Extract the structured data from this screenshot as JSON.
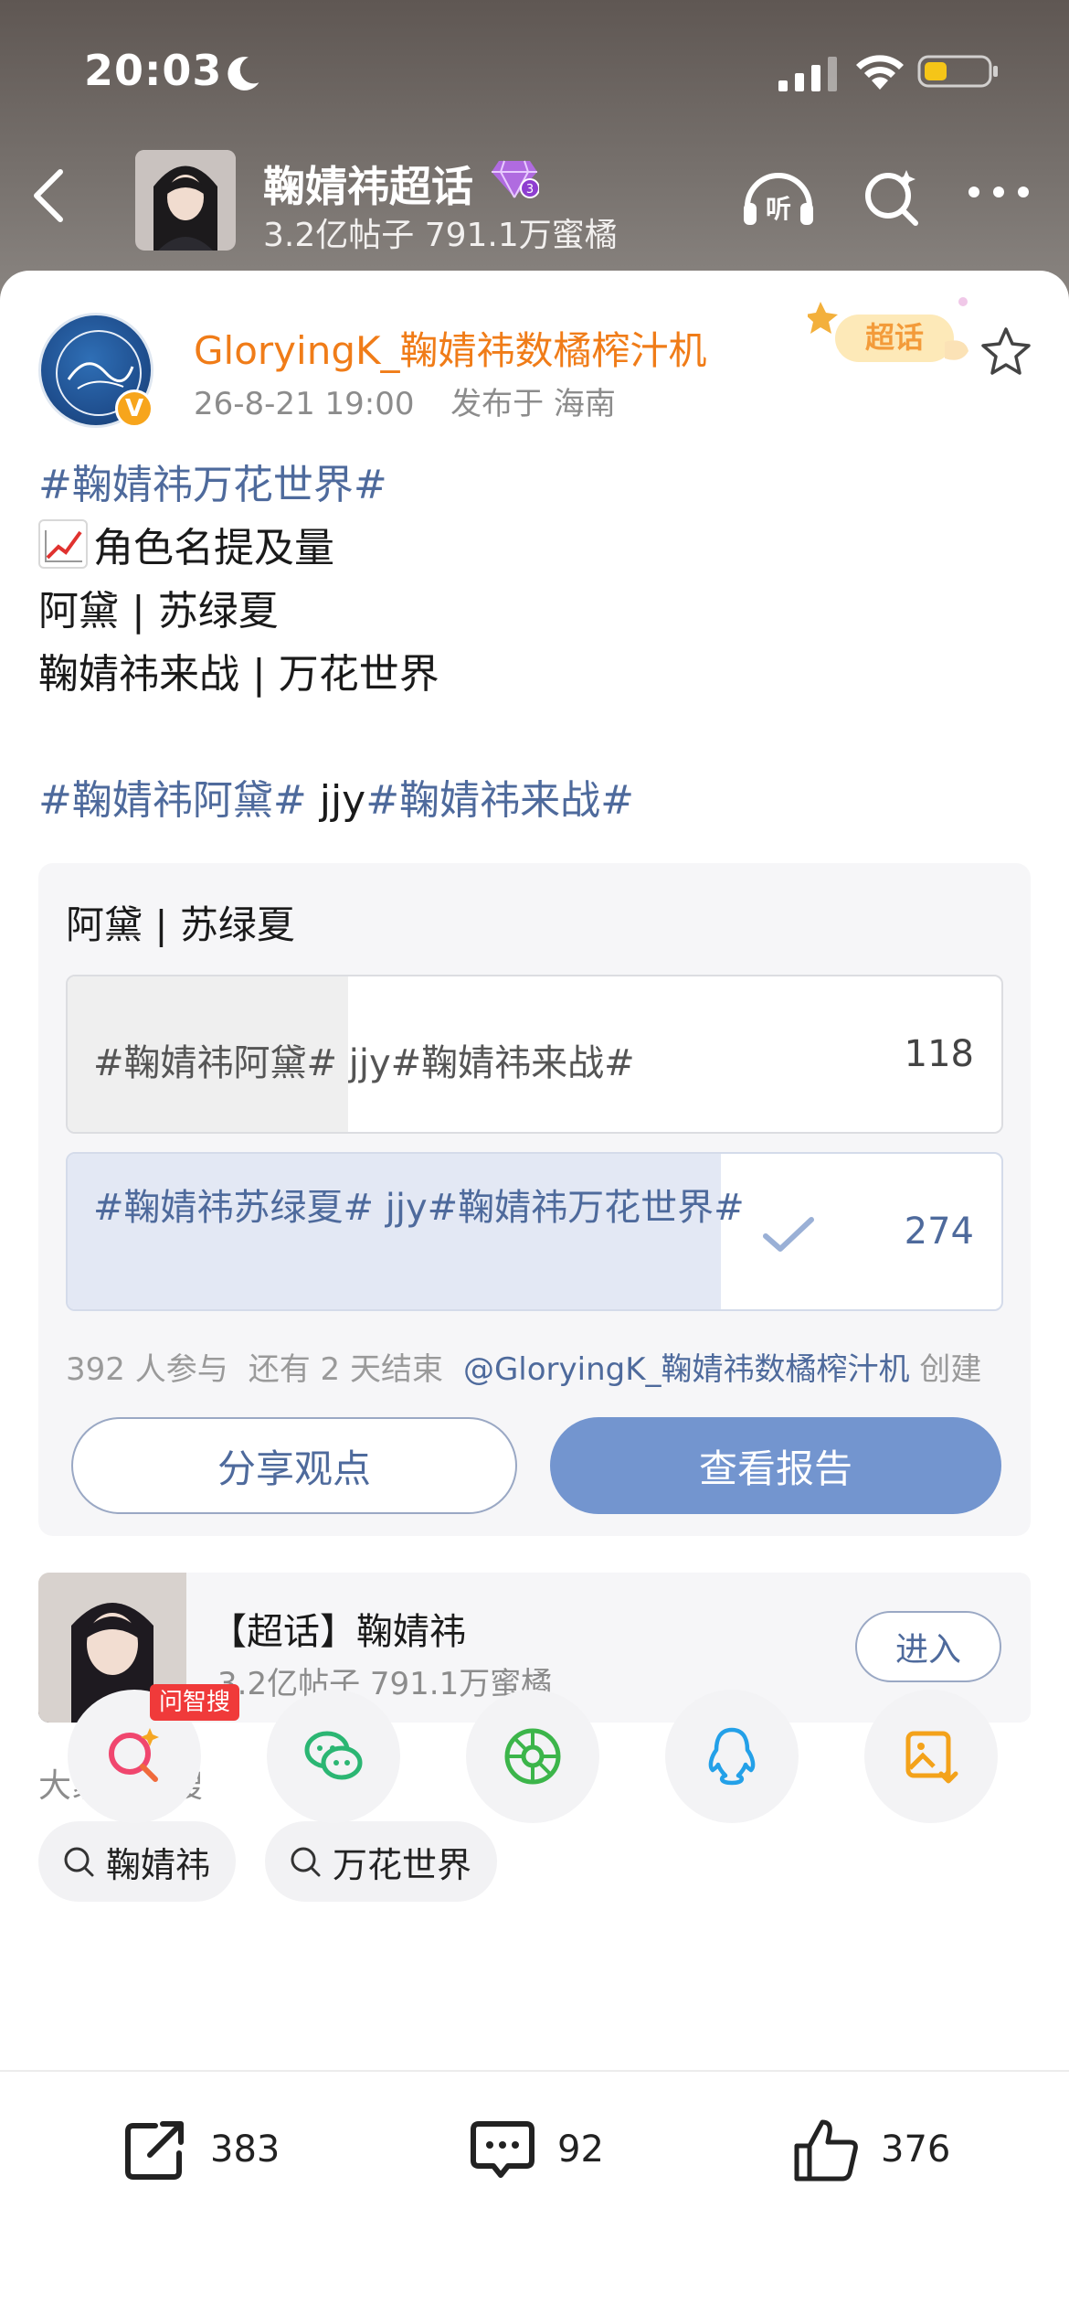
{
  "status_bar": {
    "time": "20:03"
  },
  "nav": {
    "title": "鞠婧祎超话",
    "subtitle": "3.2亿帖子 791.1万蜜橘"
  },
  "post": {
    "author": "GloryingK_鞠婧祎数橘榨汁机",
    "date": "26-8-21 19:00",
    "location": "发布于 海南",
    "supertopic_badge": "超话",
    "lines": {
      "l1": "#鞠婧祎万花世界#",
      "l2": "角色名提及量",
      "l3": "阿黛 | 苏绿夏",
      "l4": "鞠婧祎来战 | 万花世界",
      "l6_tag1": "#鞠婧祎阿黛#",
      "l6_mid": " jjy",
      "l6_tag2": "#鞠婧祎来战#"
    }
  },
  "poll": {
    "title": "阿黛 | 苏绿夏",
    "options": [
      {
        "text": "#鞠婧祎阿黛# jjy#鞠婧祎来战#",
        "count": "118",
        "share": 0.3
      },
      {
        "text": "#鞠婧祎苏绿夏# jjy#鞠婧祎万花世界#",
        "count": "274",
        "share": 0.7,
        "selected": true
      }
    ],
    "participants": "392 人参与",
    "remaining": "还有 2 天结束",
    "creator": "@GloryingK_鞠婧祎数橘榨汁机",
    "created_label": "创建",
    "share_btn": "分享观点",
    "report_btn": "查看报告"
  },
  "topic_card": {
    "name": "【超话】鞠婧祎",
    "sub": "3.2亿帖子 791.1万蜜橘",
    "enter": "进入"
  },
  "search": {
    "heading": "大家都在搜",
    "chips": [
      "鞠婧祎",
      "万花世界"
    ]
  },
  "share_targets": {
    "ai_tag": "问智搜",
    "items": [
      "ai-search-icon",
      "wechat-icon",
      "moments-icon",
      "qq-icon",
      "save-image-icon"
    ]
  },
  "actions": {
    "reposts": "383",
    "comments": "92",
    "likes": "376"
  },
  "colors": {
    "link": "#4e6a9c",
    "author": "#f07c18",
    "primary_button": "#7395cf"
  }
}
